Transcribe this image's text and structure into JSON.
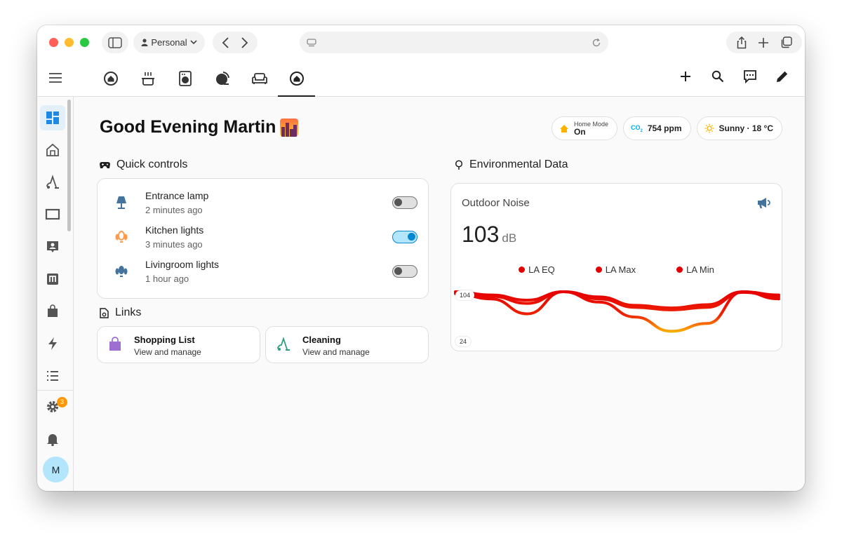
{
  "browser": {
    "profile_label": "Personal"
  },
  "header": {
    "views": [
      "home-view",
      "kitchen-view",
      "laundry-view",
      "office-view",
      "living-room-view",
      "overview-view"
    ]
  },
  "main": {
    "greeting": "Good Evening Martin",
    "chips": {
      "home_mode_label": "Home Mode",
      "home_mode_value": "On",
      "co2_value": "754 ppm",
      "weather": "Sunny · 18 °C"
    },
    "quick_controls": {
      "title": "Quick controls",
      "items": [
        {
          "name": "Entrance lamp",
          "time": "2 minutes ago",
          "on": false,
          "icon": "lamp-icon"
        },
        {
          "name": "Kitchen lights",
          "time": "3 minutes ago",
          "on": true,
          "icon": "ceiling-lights-icon"
        },
        {
          "name": "Livingroom lights",
          "time": "1 hour ago",
          "on": false,
          "icon": "ceiling-lights-icon"
        }
      ]
    },
    "links": {
      "title": "Links",
      "items": [
        {
          "title": "Shopping List",
          "subtitle": "View and manage",
          "icon": "shopping-bag-icon"
        },
        {
          "title": "Cleaning",
          "subtitle": "View and manage",
          "icon": "vacuum-icon"
        }
      ]
    },
    "environment": {
      "title": "Environmental Data",
      "card_title": "Outdoor Noise",
      "value": "103",
      "unit": "dB"
    }
  },
  "sidebar": {
    "settings_badge": "3",
    "avatar_initial": "M"
  },
  "colors": {
    "accent": "#0288d1",
    "active_nav_bg": "#e3f0f9",
    "noise_line": "#e50000",
    "home_mode_icon": "#ffb300",
    "co2_icon": "#03a9f4"
  },
  "chart_data": {
    "type": "line",
    "series": [
      {
        "name": "LA EQ",
        "values": [
          103,
          97,
          86,
          104,
          93,
          80,
          76,
          80,
          103,
          96
        ]
      },
      {
        "name": "LA Max",
        "values": [
          104,
          99,
          91,
          104,
          96,
          83,
          79,
          84,
          104,
          99
        ]
      },
      {
        "name": "LA Min",
        "values": [
          101,
          93,
          70,
          104,
          88,
          65,
          43,
          55,
          104,
          93
        ]
      }
    ],
    "ylim": [
      24,
      104
    ],
    "y_ticks": [
      "104",
      "24"
    ],
    "legend": "top"
  }
}
